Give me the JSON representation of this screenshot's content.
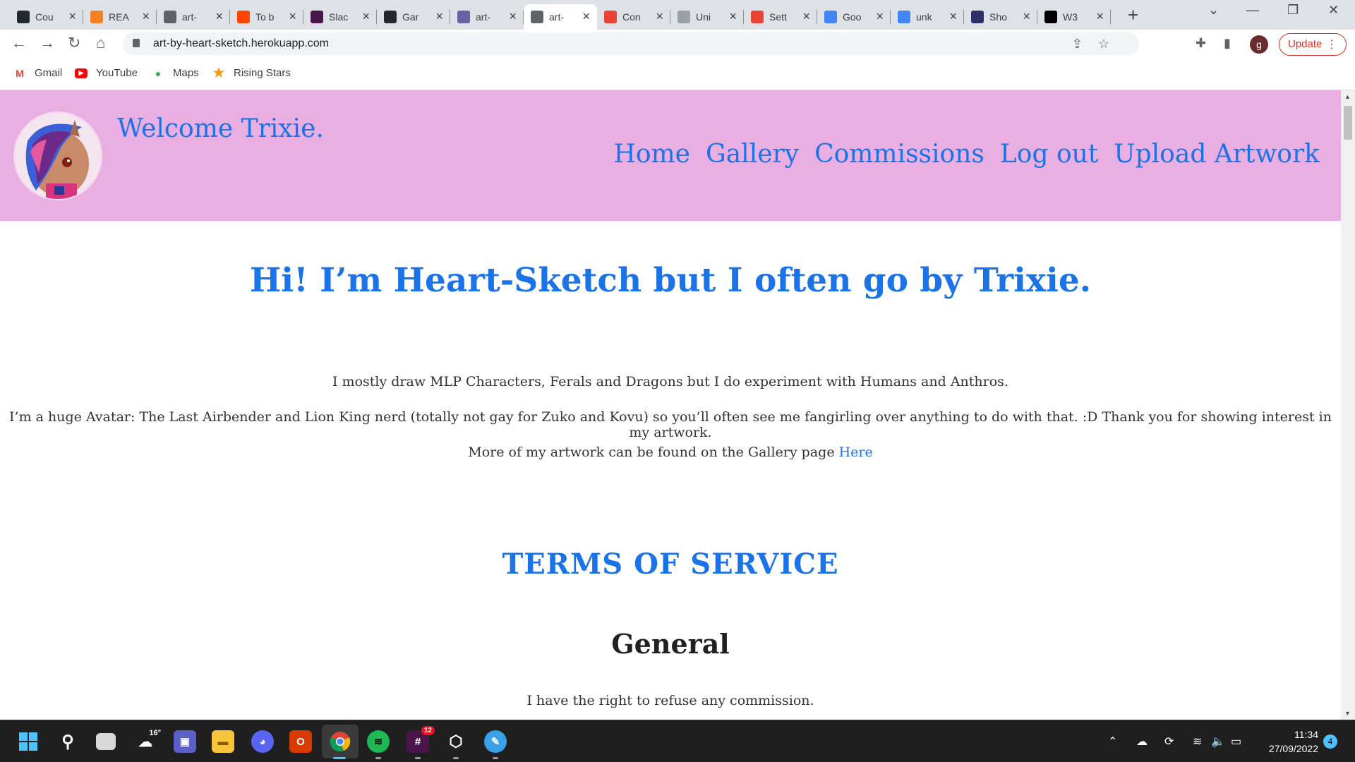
{
  "browser": {
    "tabs": [
      {
        "title": "Cou",
        "favicon": "github-icon",
        "color": "#24292f"
      },
      {
        "title": "REA",
        "favicon": "g-icon",
        "color": "#f48024"
      },
      {
        "title": "art-",
        "favicon": "globe-icon",
        "color": "#5f6368"
      },
      {
        "title": "To b",
        "favicon": "circle-icon",
        "color": "#ff4500"
      },
      {
        "title": "Slac",
        "favicon": "slack-icon",
        "color": "#4a154b"
      },
      {
        "title": "Gar",
        "favicon": "github-icon",
        "color": "#24292f"
      },
      {
        "title": "art-",
        "favicon": "heroku-icon",
        "color": "#6762a6"
      },
      {
        "title": "art-",
        "favicon": "globe-icon",
        "color": "#5f6368",
        "active": true
      },
      {
        "title": "Con",
        "favicon": "gmail-icon",
        "color": "#ea4335"
      },
      {
        "title": "Uni",
        "favicon": "unity-icon",
        "color": "#9aa0a6"
      },
      {
        "title": "Sett",
        "favicon": "gmail-icon",
        "color": "#ea4335"
      },
      {
        "title": "Goo",
        "favicon": "google-icon",
        "color": "#4285f4"
      },
      {
        "title": "unk",
        "favicon": "google-icon",
        "color": "#4285f4"
      },
      {
        "title": "Sho",
        "favicon": "shortcut-icon",
        "color": "#2d2f6b"
      },
      {
        "title": "W3",
        "favicon": "w3-icon",
        "color": "#000000"
      }
    ],
    "url": "art-by-heart-sketch.herokuapp.com",
    "profile_initial": "g",
    "update_label": "Update",
    "bookmarks": [
      {
        "label": "Gmail",
        "icon": "gmail-icon"
      },
      {
        "label": "YouTube",
        "icon": "youtube-icon"
      },
      {
        "label": "Maps",
        "icon": "maps-icon"
      },
      {
        "label": "Rising Stars",
        "icon": "star-icon"
      }
    ]
  },
  "site": {
    "welcome": "Welcome Trixie.",
    "nav": [
      "Home",
      "Gallery",
      "Commissions",
      "Log out",
      "Upload Artwork"
    ],
    "hero": "Hi! I’m Heart-Sketch but I often go by Trixie.",
    "para1": "I mostly draw MLP Characters, Ferals and Dragons but I do experiment with Humans and Anthros.",
    "para2": "I’m a huge Avatar: The Last Airbender and Lion King nerd (totally not gay for Zuko and Kovu) so you’ll often see me fangirling over anything to do with that. :D Thank you for showing interest in my artwork.",
    "para3_text": "More of my artwork can be found on the Gallery page",
    "para3_link": "Here",
    "tos_heading": "TERMS OF SERVICE",
    "general_heading": "General",
    "general_p1": "I have the right to refuse any commission.",
    "header_color": "#e9aee2",
    "link_color": "#1a73e8"
  },
  "taskbar": {
    "weather_temp": "16°",
    "slack_badge": "12",
    "time": "11:34",
    "date": "27/09/2022",
    "notification_count": "4"
  }
}
